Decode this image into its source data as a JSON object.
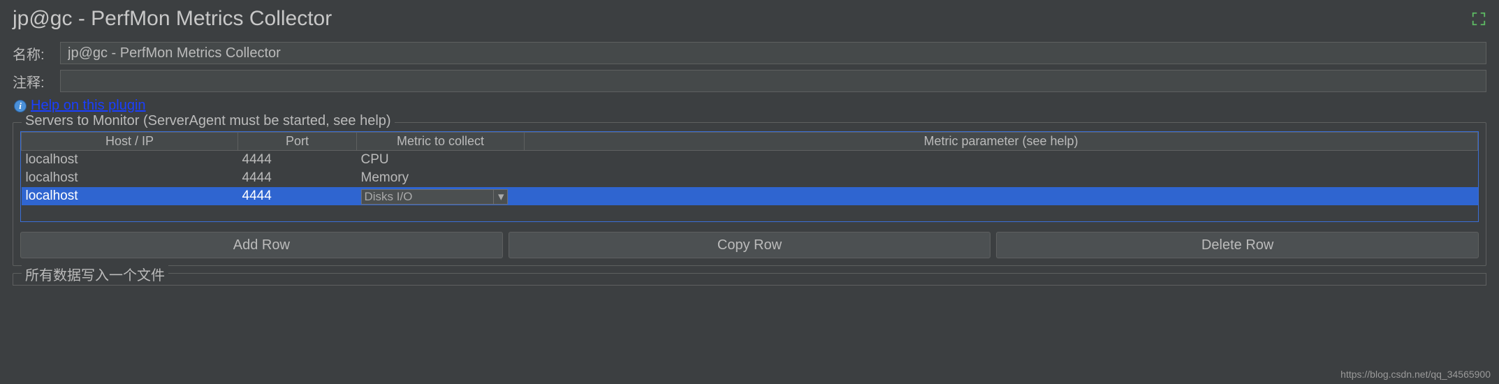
{
  "title": "jp@gc - PerfMon Metrics Collector",
  "form": {
    "name_label": "名称:",
    "name_value": "jp@gc - PerfMon Metrics Collector",
    "comment_label": "注释:",
    "comment_value": ""
  },
  "help": {
    "link_text": "Help on this plugin"
  },
  "servers_section": {
    "legend": "Servers to Monitor (ServerAgent must be started, see help)",
    "columns": {
      "host": "Host / IP",
      "port": "Port",
      "metric": "Metric to collect",
      "param": "Metric parameter (see help)"
    },
    "rows": [
      {
        "host": "localhost",
        "port": "4444",
        "metric": "CPU",
        "param": "",
        "selected": false
      },
      {
        "host": "localhost",
        "port": "4444",
        "metric": "Memory",
        "param": "",
        "selected": false
      },
      {
        "host": "localhost",
        "port": "4444",
        "metric": "Disks I/O",
        "param": "",
        "selected": true,
        "dropdown": true
      }
    ],
    "buttons": {
      "add": "Add Row",
      "copy": "Copy Row",
      "delete": "Delete Row"
    }
  },
  "file_section": {
    "legend": "所有数据写入一个文件"
  },
  "watermark": "https://blog.csdn.net/qq_34565900"
}
